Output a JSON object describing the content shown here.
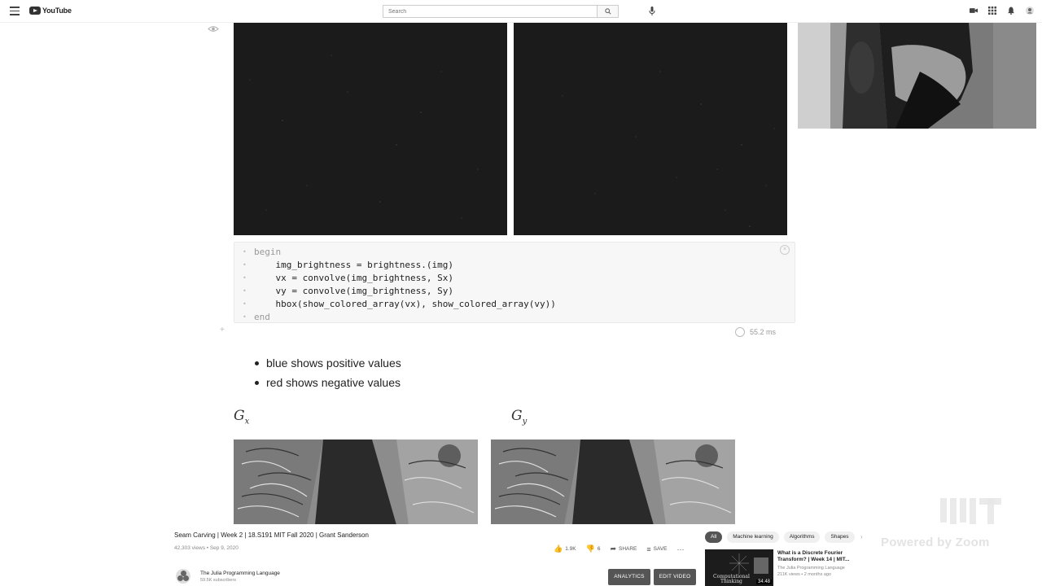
{
  "header": {
    "logo_text": "YouTube",
    "search": {
      "placeholder": "Search"
    },
    "icons": [
      "menu-icon",
      "search-icon",
      "mic-icon",
      "create-video-icon",
      "apps-icon",
      "notifications-icon",
      "account-icon"
    ]
  },
  "notebook": {
    "code_lines": [
      "begin",
      "    img_brightness = brightness.(img)",
      "    vx = convolve(img_brightness, Sx)",
      "    vy = convolve(img_brightness, Sy)",
      "    hbox(show_colored_array(vx), show_colored_array(vy))",
      "end"
    ],
    "runtime": "55.2 ms",
    "bullets": [
      "blue shows positive values",
      "red shows negative values"
    ],
    "gx_base": "G",
    "gx_sub": "x",
    "gy_base": "G",
    "gy_sub": "y"
  },
  "video": {
    "title": "Seam Carving | Week 2 | 18.S191 MIT Fall 2020 | Grant Sanderson",
    "meta": "42,303 views • Sep 9, 2020",
    "likes": "1.9K",
    "dislikes": "6",
    "share_label": "SHARE",
    "save_label": "SAVE",
    "channel_name": "The Julia Programming Language",
    "channel_subs": "59.5K subscribers",
    "analytics_label": "ANALYTICS",
    "edit_label": "EDIT VIDEO"
  },
  "sidebar": {
    "chips": [
      "All",
      "Machine learning",
      "Algorithms",
      "Shapes"
    ],
    "recommendation": {
      "title": "What is a Discrete Fourier Transform? | Week 14 | MIT...",
      "channel": "The Julia Programming Language",
      "meta": "211K views • 2 months ago",
      "duration": "34:48",
      "thumb_text_1": "Computational",
      "thumb_text_2": "Thinking"
    }
  },
  "overlay": {
    "powered_by": "Powered by Zoom"
  }
}
